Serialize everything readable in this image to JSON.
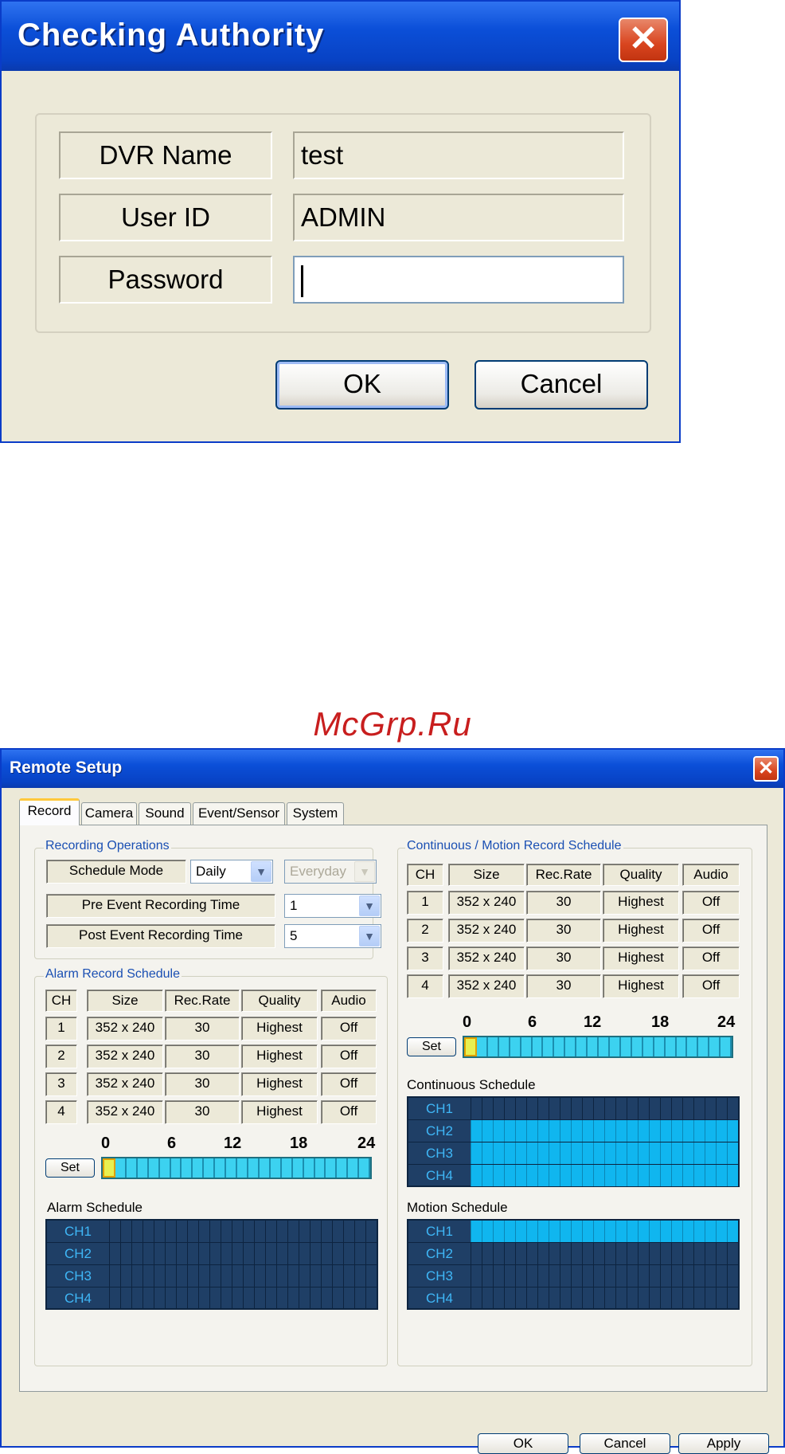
{
  "auth_dialog": {
    "title": "Checking Authority",
    "fields": [
      {
        "label": "DVR Name",
        "value": "test"
      },
      {
        "label": "User ID",
        "value": "ADMIN"
      },
      {
        "label": "Password",
        "value": ""
      }
    ],
    "ok_label": "OK",
    "cancel_label": "Cancel"
  },
  "watermark": "McGrp.Ru",
  "remote_setup": {
    "title": "Remote Setup",
    "tabs": [
      "Record",
      "Camera",
      "Sound",
      "Event/Sensor",
      "System"
    ],
    "active_tab": "Record",
    "recording_operations": {
      "title": "Recording Operations",
      "schedule_mode_label": "Schedule Mode",
      "schedule_mode_value": "Daily",
      "schedule_day_value": "Everyday",
      "pre_event_label": "Pre Event Recording Time",
      "pre_event_value": "1",
      "post_event_label": "Post Event Recording Time",
      "post_event_value": "5"
    },
    "alarm_record_schedule": {
      "title": "Alarm Record Schedule",
      "columns": [
        "CH",
        "Size",
        "Rec.Rate",
        "Quality",
        "Audio"
      ],
      "rows": [
        [
          "1",
          "352 x 240",
          "30",
          "Highest",
          "Off"
        ],
        [
          "2",
          "352 x 240",
          "30",
          "Highest",
          "Off"
        ],
        [
          "3",
          "352 x 240",
          "30",
          "Highest",
          "Off"
        ],
        [
          "4",
          "352 x 240",
          "30",
          "Highest",
          "Off"
        ]
      ],
      "hour_ticks": [
        "0",
        "6",
        "12",
        "18",
        "24"
      ],
      "set_label": "Set",
      "schedule_label": "Alarm Schedule",
      "channels": [
        "CH1",
        "CH2",
        "CH3",
        "CH4"
      ]
    },
    "continuous_motion_schedule": {
      "title": "Continuous / Motion Record Schedule",
      "columns": [
        "CH",
        "Size",
        "Rec.Rate",
        "Quality",
        "Audio"
      ],
      "rows": [
        [
          "1",
          "352 x 240",
          "30",
          "Highest",
          "Off"
        ],
        [
          "2",
          "352 x 240",
          "30",
          "Highest",
          "Off"
        ],
        [
          "3",
          "352 x 240",
          "30",
          "Highest",
          "Off"
        ],
        [
          "4",
          "352 x 240",
          "30",
          "Highest",
          "Off"
        ]
      ],
      "hour_ticks": [
        "0",
        "6",
        "12",
        "18",
        "24"
      ],
      "set_label": "Set",
      "continuous_label": "Continuous Schedule",
      "motion_label": "Motion  Schedule",
      "channels": [
        "CH1",
        "CH2",
        "CH3",
        "CH4"
      ]
    },
    "ok_label": "OK",
    "cancel_label": "Cancel",
    "apply_label": "Apply"
  }
}
